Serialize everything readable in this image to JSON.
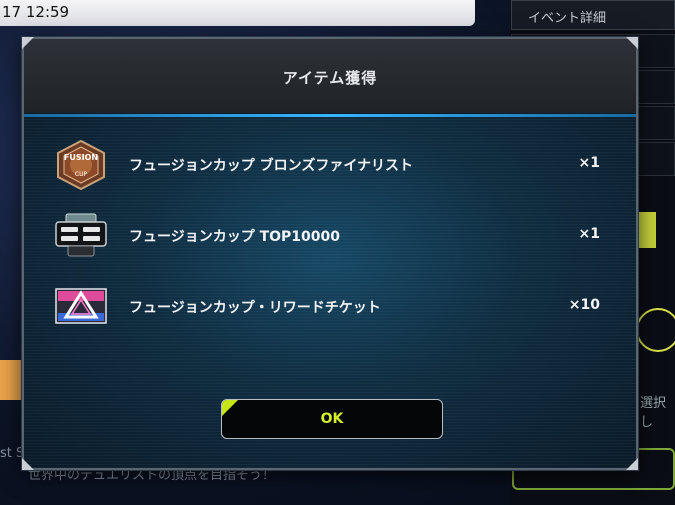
{
  "background": {
    "clock": "17 12:59",
    "event_detail": "イベント詳細",
    "select_text": "選択し",
    "bottom_text": "世界中のデュエリストの頂点を目指そう！",
    "side_text": "st S"
  },
  "modal": {
    "title": "アイテム獲得",
    "items": [
      {
        "name": "フュージョンカップ ブロンズファイナリスト",
        "qty": "×1",
        "icon": "fusion-cup-bronze-medal-icon"
      },
      {
        "name": "フュージョンカップ TOP10000",
        "qty": "×1",
        "icon": "top10000-card-icon"
      },
      {
        "name": "フュージョンカップ・リワードチケット",
        "qty": "×10",
        "icon": "reward-ticket-icon"
      }
    ],
    "ok_label": "OK"
  },
  "colors": {
    "accent_cyan": "#38b6ff",
    "ok_yellow": "#d4ef2a",
    "header_bg": "#2e3137"
  }
}
